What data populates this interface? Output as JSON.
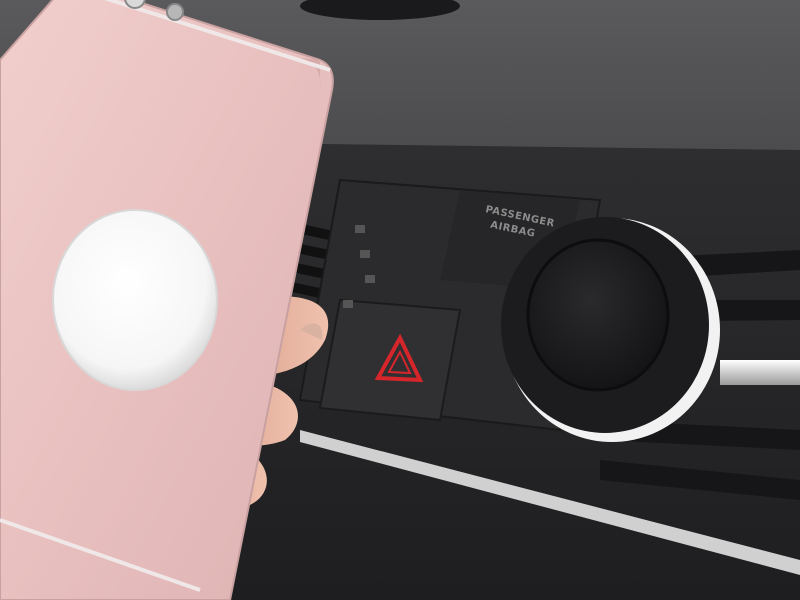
{
  "photo": {
    "subject": "phone-with-magnetic-plate-and-vent-mount",
    "airbag_panel": {
      "line1": "PASSENGER",
      "line2": "AIRBAG"
    },
    "colors": {
      "dashboard": "#3b3b3d",
      "phone_body": "#e9c3c3",
      "metal_plate": "#f7f7f7",
      "mount_black": "#1c1c1e",
      "hazard_red": "#d6262b",
      "chrome_trim": "#d8d8d8"
    }
  }
}
